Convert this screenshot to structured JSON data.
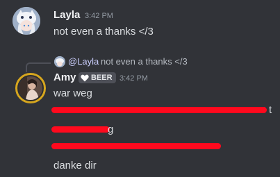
{
  "messages": [
    {
      "author": "Layla",
      "timestamp": "3:42 PM",
      "text": "not even a thanks </3"
    },
    {
      "reply": {
        "author": "@Layla",
        "text": "not even a thanks </3"
      },
      "author": "Amy",
      "badge": "BEER",
      "timestamp": "3:42 PM",
      "lines": {
        "first": "war weg",
        "last": "danke dir",
        "fragment_g": "g",
        "fragment_t": "t"
      }
    }
  ],
  "colors": {
    "background": "#313338",
    "redaction": "#ff0a1e",
    "avatar_ring": "#d6a61e"
  }
}
